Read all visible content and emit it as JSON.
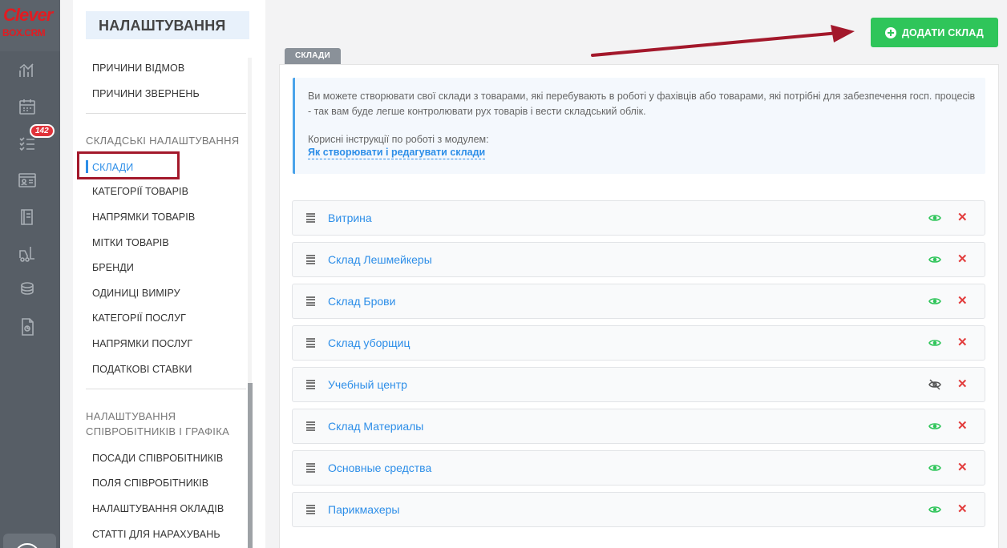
{
  "brand": {
    "line1": "Clever",
    "line2": "BOX.CRM"
  },
  "rail": {
    "badge": "142",
    "icons": [
      "analytics-icon",
      "calendar-icon",
      "tasks-icon",
      "contacts-card-icon",
      "book-icon",
      "forklift-icon",
      "coins-icon",
      "report-icon"
    ]
  },
  "settings": {
    "title": "НАЛАШТУВАННЯ",
    "items_top": [
      "ПРИЧИНИ ВІДМОВ",
      "ПРИЧИНИ ЗВЕРНЕНЬ"
    ],
    "section_warehouse": "СКЛАДСЬКІ НАЛАШТУВАННЯ",
    "warehouse_items": [
      "СКЛАДИ",
      "КАТЕГОРІЇ ТОВАРІВ",
      "НАПРЯМКИ ТОВАРІВ",
      "МІТКИ ТОВАРІВ",
      "БРЕНДИ",
      "ОДИНИЦІ ВИМІРУ",
      "КАТЕГОРІЇ ПОСЛУГ",
      "НАПРЯМКИ ПОСЛУГ",
      "ПОДАТКОВІ СТАВКИ"
    ],
    "section_employees_1": "НАЛАШТУВАННЯ",
    "section_employees_2": "СПІВРОБІТНИКІВ І ГРАФІКА",
    "employee_items": [
      "ПОСАДИ СПІВРОБІТНИКІВ",
      "ПОЛЯ СПІВРОБІТНИКІВ",
      "НАЛАШТУВАННЯ ОКЛАДІВ",
      "СТАТТІ ДЛЯ НАРАХУВАНЬ"
    ]
  },
  "main": {
    "add_button": "ДОДАТИ СКЛАД",
    "tab": "СКЛАДИ",
    "info_line1": "Ви можете створювати свої склади з товарами, які перебувають в роботі у фахівців або товарами, які потрібні для забезпечення госп. процесів",
    "info_line2": "- так вам буде легше контролювати рух товарів і вести складський облік.",
    "info_useful": "Корисні інструкції по роботі з модулем:",
    "info_link": "Як створювати і редагувати склади",
    "warehouses": [
      {
        "name": "Витрина",
        "visible": true
      },
      {
        "name": "Склад Лешмейкеры",
        "visible": true
      },
      {
        "name": "Склад Брови",
        "visible": true
      },
      {
        "name": "Склад уборщиц",
        "visible": true
      },
      {
        "name": "Учебный центр",
        "visible": false
      },
      {
        "name": "Склад Материалы",
        "visible": true
      },
      {
        "name": "Основные средства",
        "visible": true
      },
      {
        "name": "Парикмахеры",
        "visible": true
      }
    ],
    "colors": {
      "accent": "#2d8ee8",
      "add": "#2fc55a",
      "eye": "#2fc55a",
      "delete": "#e23c3c",
      "highlight": "#a3182b"
    }
  }
}
